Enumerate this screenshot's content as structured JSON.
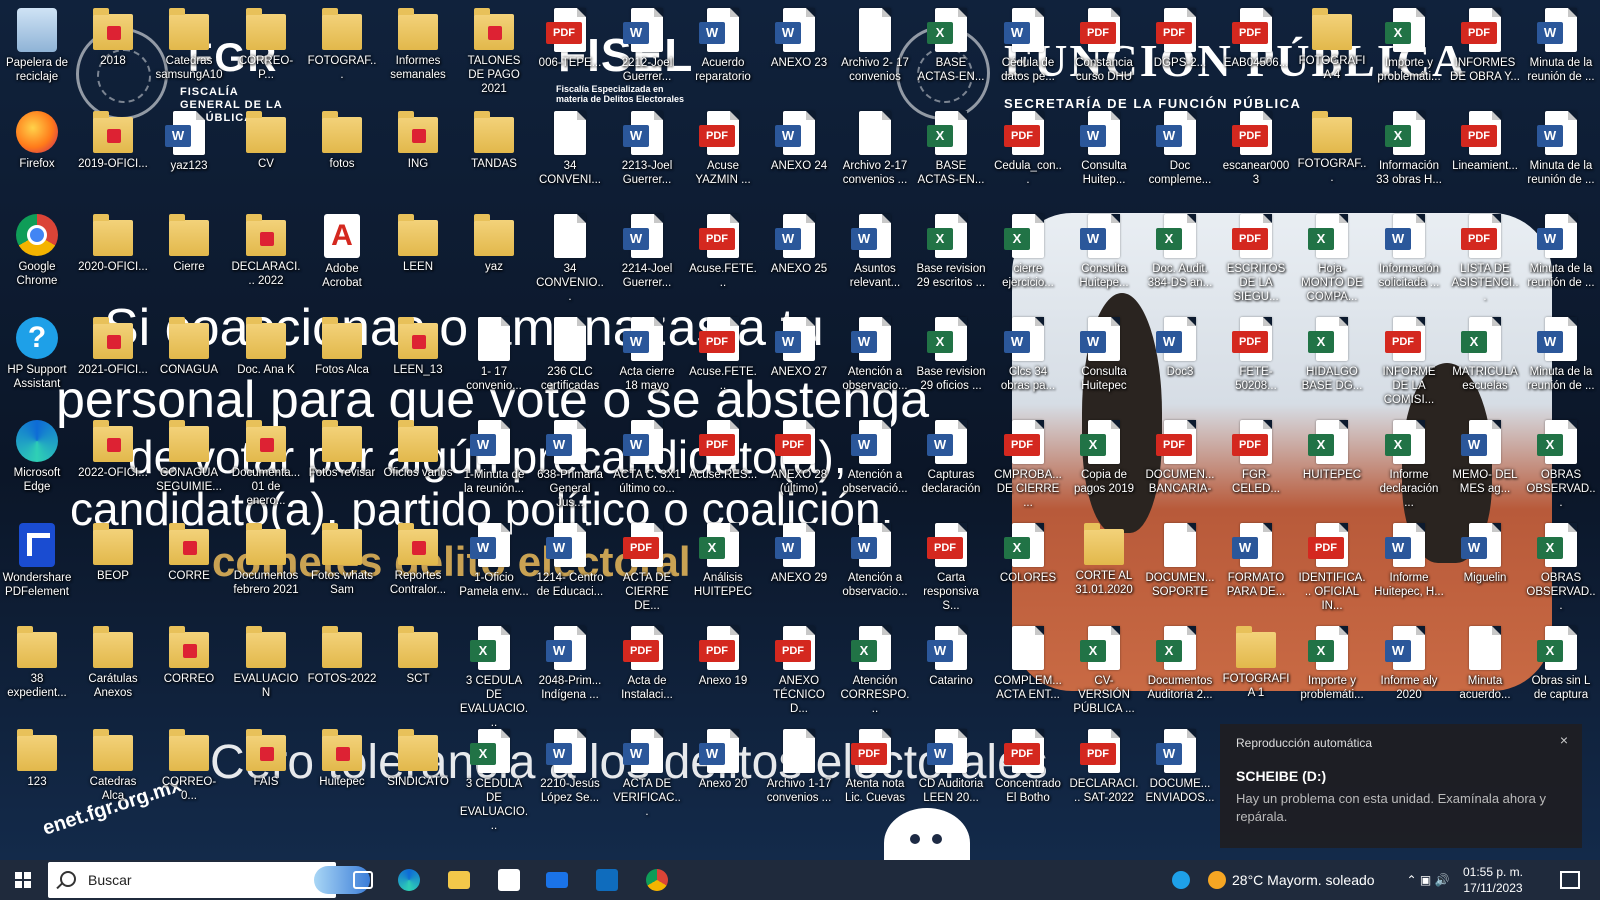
{
  "wallpaper": {
    "fgr_abbr": "FGR",
    "fgr_name": "FISCALÍA GENERAL DE LA REPÚBLICA",
    "fisel": "FISEL",
    "fisel_sub": "Fiscalía Especializada en materia de Delitos Electorales",
    "fp_title": "FUNCIÓN PÚBLICA",
    "fp_sub": "SECRETARÍA DE LA FUNCIÓN PÚBLICA",
    "wm_line1": "Si coaccionas o amenazas a tu",
    "wm_line2": "personal para que vote o se abstenga",
    "wm_line3": "de votar por algún precandidato(a),",
    "wm_line4": "candidato(a), partido político o coalición,",
    "wm_line5": "cometes delito electoral",
    "wm_line6": "Cero tolerancia a los delitos electorales",
    "enet": "enet.fgr.org.mx"
  },
  "desktop": {
    "icons": [
      {
        "label": "Papelera de reciclaje",
        "type": "bin"
      },
      {
        "label": "2018",
        "type": "folder-pdf"
      },
      {
        "label": "Catedras samsungA10",
        "type": "folder"
      },
      {
        "label": "CORREO-P...",
        "type": "folder"
      },
      {
        "label": "FOTOGRAF...",
        "type": "folder"
      },
      {
        "label": "Informes semanales",
        "type": "folder"
      },
      {
        "label": "TALONES DE PAGO 2021",
        "type": "folder-pdf"
      },
      {
        "label": "006-TEPE...",
        "type": "pdf"
      },
      {
        "label": "2212-Joel Guerrer...",
        "type": "word"
      },
      {
        "label": "Acuerdo reparatorio",
        "type": "word"
      },
      {
        "label": "ANEXO 23",
        "type": "word"
      },
      {
        "label": "Archivo 2- 17 convenios",
        "type": "doc"
      },
      {
        "label": "BASE ACTAS-EN...",
        "type": "excel"
      },
      {
        "label": "Cédula de datos pe...",
        "type": "word"
      },
      {
        "label": "Constancia curso DHU",
        "type": "pdf"
      },
      {
        "label": "DGPS-2...",
        "type": "pdf"
      },
      {
        "label": "EAB04506...",
        "type": "pdf"
      },
      {
        "label": "FOTOGRAFIA 4",
        "type": "folder"
      },
      {
        "label": "Importe y problemáti...",
        "type": "excel"
      },
      {
        "label": "INFORMES DE OBRA Y...",
        "type": "pdf"
      },
      {
        "label": "Minuta de la reunión de ...",
        "type": "word"
      },
      {
        "label": "Firefox",
        "type": "firefox"
      },
      {
        "label": "2019-OFICI...",
        "type": "folder-pdf"
      },
      {
        "label": "yaz123",
        "type": "word"
      },
      {
        "label": "CV",
        "type": "folder"
      },
      {
        "label": "fotos",
        "type": "folder"
      },
      {
        "label": "ING",
        "type": "folder-pdf"
      },
      {
        "label": "TANDAS",
        "type": "folder"
      },
      {
        "label": "34 CONVENI...",
        "type": "doc"
      },
      {
        "label": "2213-Joel Guerrer...",
        "type": "word"
      },
      {
        "label": "Acuse YAZMIN ...",
        "type": "pdf"
      },
      {
        "label": "ANEXO 24",
        "type": "word"
      },
      {
        "label": "Archivo 2-17 convenios ...",
        "type": "doc"
      },
      {
        "label": "BASE ACTAS-EN...",
        "type": "excel"
      },
      {
        "label": "Cedula_con...",
        "type": "pdf"
      },
      {
        "label": "Consulta Huitep...",
        "type": "word"
      },
      {
        "label": "Doc compleme...",
        "type": "word"
      },
      {
        "label": "escanear0003",
        "type": "pdf"
      },
      {
        "label": "FOTOGRAF...",
        "type": "folder"
      },
      {
        "label": "Información 33 obras H...",
        "type": "excel"
      },
      {
        "label": "Lineamient...",
        "type": "pdf"
      },
      {
        "label": "Minuta de la reunión de ...",
        "type": "word"
      },
      {
        "label": "Google Chrome",
        "type": "chrome"
      },
      {
        "label": "2020-OFICI...",
        "type": "folder"
      },
      {
        "label": "Cierre",
        "type": "folder"
      },
      {
        "label": "DECLARACI... 2022",
        "type": "folder-pdf"
      },
      {
        "label": "Adobe Acrobat",
        "type": "acrobat"
      },
      {
        "label": "LEEN",
        "type": "folder"
      },
      {
        "label": "yaz",
        "type": "folder"
      },
      {
        "label": "34 CONVENIO...",
        "type": "doc"
      },
      {
        "label": "2214-Joel Guerrer...",
        "type": "word"
      },
      {
        "label": "Acuse.FETE...",
        "type": "pdf"
      },
      {
        "label": "ANEXO 25",
        "type": "word"
      },
      {
        "label": "Asuntos relevant...",
        "type": "word"
      },
      {
        "label": "Base revision 29 escritos ...",
        "type": "excel"
      },
      {
        "label": "cierre ejercicio...",
        "type": "excel"
      },
      {
        "label": "Consulta Huitepe...",
        "type": "word"
      },
      {
        "label": "Doc. Audit. 384-DS an...",
        "type": "excel"
      },
      {
        "label": "ESCRITOS DE LA SIEGU...",
        "type": "pdf"
      },
      {
        "label": "Hoja-MONTO DE COMPA...",
        "type": "excel"
      },
      {
        "label": "Información solicitada ...",
        "type": "word"
      },
      {
        "label": "LISTA DE ASISTENCI...",
        "type": "pdf"
      },
      {
        "label": "Minuta de la reunión de ...",
        "type": "word"
      },
      {
        "label": "HP Support Assistant",
        "type": "help"
      },
      {
        "label": "2021-OFICI...",
        "type": "folder-pdf"
      },
      {
        "label": "CONAGUA",
        "type": "folder"
      },
      {
        "label": "Doc. Ana K",
        "type": "folder"
      },
      {
        "label": "Fotos Alca",
        "type": "folder"
      },
      {
        "label": "LEEN_13",
        "type": "folder-pdf"
      },
      {
        "label": "1- 17 convenio...",
        "type": "doc"
      },
      {
        "label": "236 CLC certificadas",
        "type": "doc"
      },
      {
        "label": "Acta cierre 18 mayo",
        "type": "word"
      },
      {
        "label": "Acuse.FETE...",
        "type": "pdf"
      },
      {
        "label": "ANEXO 27",
        "type": "word"
      },
      {
        "label": "Atención a observacio...",
        "type": "word"
      },
      {
        "label": "Base revision 29 oficios ...",
        "type": "excel"
      },
      {
        "label": "Clcs 34 obras pa...",
        "type": "word"
      },
      {
        "label": "Consulta Huitepec",
        "type": "word"
      },
      {
        "label": "Doc3",
        "type": "word"
      },
      {
        "label": "FETE-50208...",
        "type": "pdf"
      },
      {
        "label": "HIDALGO BASE DG...",
        "type": "excel"
      },
      {
        "label": "INFORME DE LA COMISI...",
        "type": "pdf"
      },
      {
        "label": "MATRICULA escuelas",
        "type": "excel"
      },
      {
        "label": "Minuta de la reunión de ...",
        "type": "word"
      },
      {
        "label": "Microsoft Edge",
        "type": "edge"
      },
      {
        "label": "2022-OFICI...",
        "type": "folder-pdf"
      },
      {
        "label": "CONAGUA SEGUIMIE...",
        "type": "folder"
      },
      {
        "label": "Documenta... 01 de enero...",
        "type": "folder-pdf"
      },
      {
        "label": "Fotos revisar",
        "type": "folder"
      },
      {
        "label": "Oficios varios",
        "type": "folder"
      },
      {
        "label": "1-Minuta de la reunión...",
        "type": "word"
      },
      {
        "label": "638-Primaria General Jus...",
        "type": "word"
      },
      {
        "label": "ACTA C. 3X1 último co...",
        "type": "word"
      },
      {
        "label": "Acuse.RES...",
        "type": "pdf"
      },
      {
        "label": "ANEXO 28 (último)",
        "type": "pdf"
      },
      {
        "label": "Atención a observació...",
        "type": "word"
      },
      {
        "label": "Capturas declaración",
        "type": "word"
      },
      {
        "label": "CMPROBA... DE CIERRE ...",
        "type": "pdf"
      },
      {
        "label": "Copia de pagos 2019",
        "type": "excel"
      },
      {
        "label": "DOCUMEN... BANCARIA-",
        "type": "pdf"
      },
      {
        "label": "FGR-CELED...",
        "type": "pdf"
      },
      {
        "label": "HUITEPEC",
        "type": "excel"
      },
      {
        "label": "Informe declaración ...",
        "type": "excel"
      },
      {
        "label": "MEMO- DEL MES ag...",
        "type": "word"
      },
      {
        "label": "OBRAS OBSERVAD...",
        "type": "excel"
      },
      {
        "label": "Wondershare PDFelement",
        "type": "wondershare"
      },
      {
        "label": "BEOP",
        "type": "folder"
      },
      {
        "label": "CORRE",
        "type": "folder-pdf"
      },
      {
        "label": "Documentos febrero 2021",
        "type": "folder"
      },
      {
        "label": "Fotos whats Sam",
        "type": "folder"
      },
      {
        "label": "Reportes Contralor...",
        "type": "folder-pdf"
      },
      {
        "label": "1-Oficio Pamela env...",
        "type": "word"
      },
      {
        "label": "1214- Centro de Educaci...",
        "type": "word"
      },
      {
        "label": "ACTA DE CIERRE DE...",
        "type": "pdf"
      },
      {
        "label": "Análisis HUITEPEC",
        "type": "excel"
      },
      {
        "label": "ANEXO 29",
        "type": "word"
      },
      {
        "label": "Atención a observacio...",
        "type": "word"
      },
      {
        "label": "Carta responsiva S...",
        "type": "pdf"
      },
      {
        "label": "COLORES",
        "type": "excel"
      },
      {
        "label": "CORTE AL 31.01.2020",
        "type": "folder"
      },
      {
        "label": "DOCUMEN... SOPORTE",
        "type": "doc"
      },
      {
        "label": "FORMATO PARA DE...",
        "type": "word"
      },
      {
        "label": "IDENTIFICA... OFICIAL IN...",
        "type": "pdf"
      },
      {
        "label": "Informe Huitepec, H...",
        "type": "word"
      },
      {
        "label": "Miguelin",
        "type": "word"
      },
      {
        "label": "OBRAS OBSERVAD...",
        "type": "excel"
      },
      {
        "label": "38 expedient...",
        "type": "folder"
      },
      {
        "label": "Carátulas Anexos",
        "type": "folder"
      },
      {
        "label": "CORREO",
        "type": "folder-pdf"
      },
      {
        "label": "EVALUACION",
        "type": "folder"
      },
      {
        "label": "FOTOS-2022",
        "type": "folder"
      },
      {
        "label": "SCT",
        "type": "folder"
      },
      {
        "label": "3 CEDULA DE EVALUACIO...",
        "type": "excel"
      },
      {
        "label": "2048-Prim... Indígena ...",
        "type": "word"
      },
      {
        "label": "Acta de Instalaci...",
        "type": "pdf"
      },
      {
        "label": "Anexo 19",
        "type": "pdf"
      },
      {
        "label": "ANEXO TÉCNICO D...",
        "type": "pdf"
      },
      {
        "label": "Atención CORRESPO...",
        "type": "excel"
      },
      {
        "label": "Catarino",
        "type": "word"
      },
      {
        "label": "COMPLEM... ACTA ENT...",
        "type": "doc"
      },
      {
        "label": "CV-VERSIÓN PÚBLICA ...",
        "type": "excel"
      },
      {
        "label": "Documentos Auditoría 2...",
        "type": "excel"
      },
      {
        "label": "FOTOGRAFIA 1",
        "type": "folder"
      },
      {
        "label": "Importe y problemáti...",
        "type": "excel"
      },
      {
        "label": "Informe aly 2020",
        "type": "word"
      },
      {
        "label": "Minuta acuerdo...",
        "type": "doc"
      },
      {
        "label": "Obras sin L de captura",
        "type": "excel"
      },
      {
        "label": "123",
        "type": "folder"
      },
      {
        "label": "Catedras Alca",
        "type": "folder"
      },
      {
        "label": "CORREO-0...",
        "type": "folder"
      },
      {
        "label": "FAIS",
        "type": "folder-pdf"
      },
      {
        "label": "Huitepec",
        "type": "folder-pdf"
      },
      {
        "label": "SINDICATO",
        "type": "folder"
      },
      {
        "label": "3 CEDULA DE EVALUACIO...",
        "type": "excel"
      },
      {
        "label": "2210-Jesús López Se...",
        "type": "word"
      },
      {
        "label": "ACTA DE VERIFICAC...",
        "type": "word"
      },
      {
        "label": "Anexo 20",
        "type": "word"
      },
      {
        "label": "Archivo 1-17 convenios ...",
        "type": "doc"
      },
      {
        "label": "Atenta nota Lic. Cuevas",
        "type": "pdf"
      },
      {
        "label": "CD Auditoria LEEN 20...",
        "type": "word"
      },
      {
        "label": "Concentrado El Botho",
        "type": "pdf"
      },
      {
        "label": "DECLARACI... SAT-2022",
        "type": "pdf"
      },
      {
        "label": "DOCUME... ENVIADOS...",
        "type": "word"
      }
    ]
  },
  "notification": {
    "header": "Reproducción automática",
    "close": "×",
    "title": "SCHEIBE (D:)",
    "body": "Hay un problema con esta unidad. Examínala ahora y repárala."
  },
  "taskbar": {
    "search_placeholder": "Buscar",
    "weather_temp": "28°C",
    "weather_text": "Mayorm. soleado",
    "time": "01:55 p. m.",
    "date": "17/11/2023",
    "pinned": [
      "task-view",
      "edge",
      "file-explorer",
      "store",
      "mail",
      "outlook",
      "chrome"
    ]
  },
  "colors": {
    "word": "#2b579a",
    "excel": "#217346",
    "pdf": "#d4281f",
    "folder": "#e8c15a",
    "taskbar": "#1f2a3c"
  }
}
